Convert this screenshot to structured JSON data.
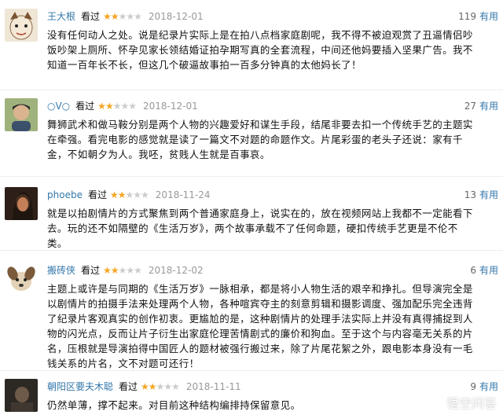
{
  "reviews": [
    {
      "user": "王大根",
      "watched": "看过",
      "rating": 2,
      "date": "2018-12-01",
      "votes": "119",
      "useful": "有用",
      "avatar_color": "#d8c9b0",
      "content": "没有任何动人之处。说是纪录片实际上是在拍八点档家庭剧呢，我不得不被迫观赏了丑逼情侣吵饭吵架上厕所、怀孕见家长领结婚证拍孕期写真的全套流程，中间还他妈要插入坚果广告。我不知道一百年长不长，但这几个破逼故事拍一百多分钟真的太他妈长了！"
    },
    {
      "user": "○V○",
      "watched": "看过",
      "rating": 2,
      "date": "2018-12-01",
      "votes": "27",
      "useful": "有用",
      "avatar_color": "#6b8a4e",
      "content": "舞狮武术和做马鞍分别是两个人物的兴趣爱好和谋生手段，结尾非要去扣一个传统手艺的主题实在牵强。看完电影的感觉就是读了一篇文不对题的命题作文。片尾彩蛋的老头子还说：家有千金，不如朝夕为人。我呸，贫贱人生就是百事哀。"
    },
    {
      "user": "phoebe",
      "watched": "看过",
      "rating": 2,
      "date": "2018-11-24",
      "votes": "13",
      "useful": "有用",
      "avatar_color": "#5a3a2a",
      "content": "就是以拍剧情片的方式聚焦到两个普通家庭身上，说实在的，放在视频网站上我都不一定能看下去。玩的还不如隔壁的《生活万岁》，两个故事承载不了任何命题，硬扣传统手艺更是不伦不类。"
    },
    {
      "user": "搬砖侠",
      "watched": "看过",
      "rating": 2,
      "date": "2018-12-02",
      "votes": "6",
      "useful": "有用",
      "avatar_color": "#e8dcc8",
      "content": "主题上或许是与同期的《生活万岁》一脉相承，都是将小人物生活的艰辛和挣扎。但导演完全是以剧情片的拍摄手法来处理两个人物，各种喧宾夺主的刻意剪辑和摄影调度、强加配乐完全违背了纪录片客观真实的创作初衷。更尴尬的是，这种剧情片的处理手法实际上并没有真得捕捉到人物的闪光点，反而让片子衍生出家庭伦理苦情剧式的廉价和狗血。至于这个与内容毫无关系的片名，压根就是导演拍得中国匠人的题材被强行搬过来，除了片尾花絮之外，跟电影本身没有一毛钱关系的片名，文不对题可还行！"
    },
    {
      "user": "朝阳区要夫木聪",
      "watched": "看过",
      "rating": 2,
      "date": "2018-11-11",
      "votes": "9",
      "useful": "有用",
      "avatar_color": "#3a3530",
      "content": "仍然单薄，撑不起来。对目前这种结构编排持保留意见。"
    }
  ],
  "watermark": "悟空问答"
}
